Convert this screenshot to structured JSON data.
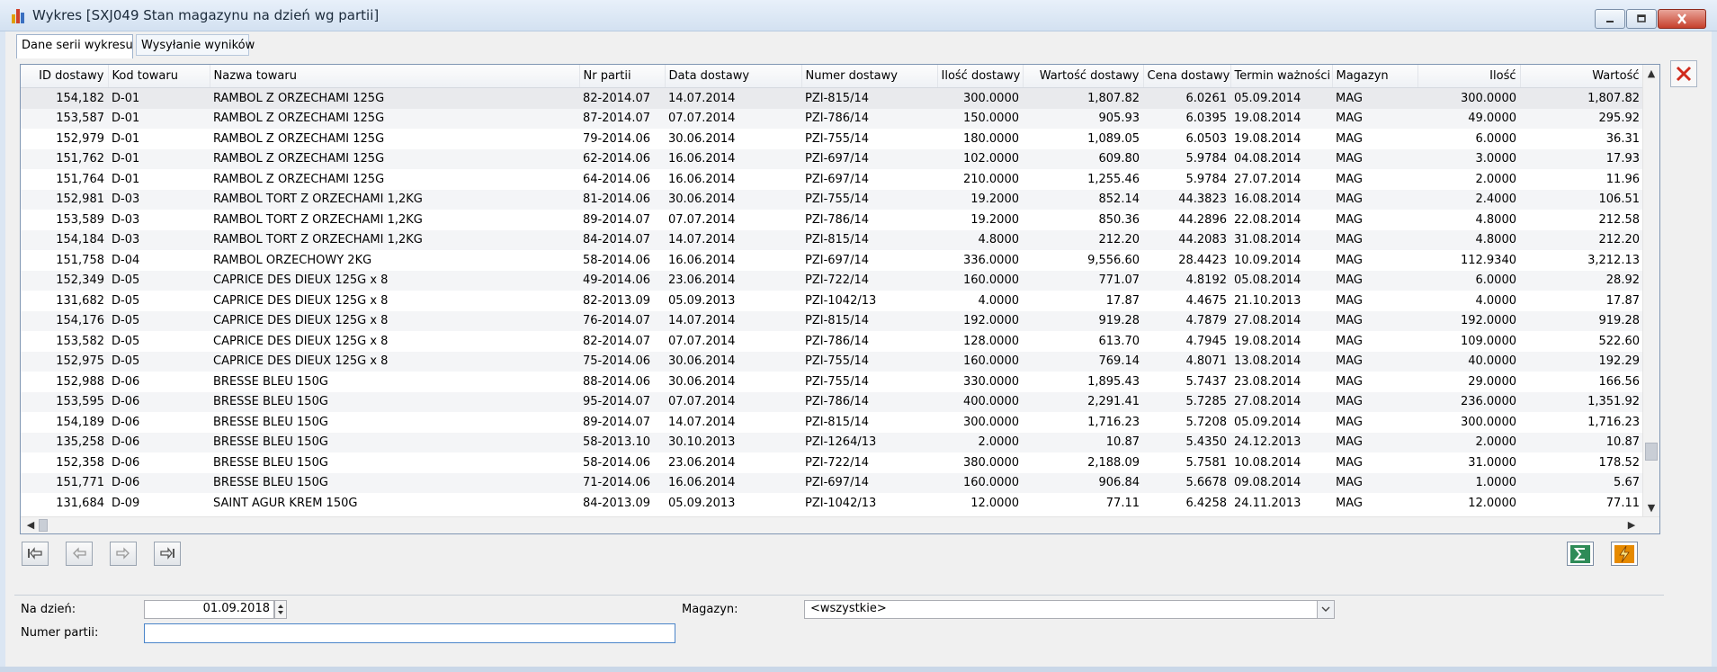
{
  "window": {
    "title": "Wykres [SXJ049 Stan magazynu na dzień wg partii]"
  },
  "tabs": [
    {
      "label": "Dane serii wykresu",
      "active": true
    },
    {
      "label": "Wysyłanie wyników",
      "active": false
    }
  ],
  "grid": {
    "columns": [
      "ID dostawy",
      "Kod towaru",
      "Nazwa towaru",
      "Nr partii",
      "Data dostawy",
      "Numer dostawy",
      "Ilość dostawy",
      "Wartość dostawy",
      "Cena dostawy",
      "Termin ważności",
      "Magazyn",
      "Ilość",
      "Wartość"
    ],
    "rows": [
      [
        "154,182",
        "D-01",
        "RAMBOL Z ORZECHAMI 125G",
        "82-2014.07",
        "14.07.2014",
        "PZI-815/14",
        "300.0000",
        "1,807.82",
        "6.0261",
        "05.09.2014",
        "MAG",
        "300.0000",
        "1,807.82"
      ],
      [
        "153,587",
        "D-01",
        "RAMBOL Z ORZECHAMI 125G",
        "87-2014.07",
        "07.07.2014",
        "PZI-786/14",
        "150.0000",
        "905.93",
        "6.0395",
        "19.08.2014",
        "MAG",
        "49.0000",
        "295.92"
      ],
      [
        "152,979",
        "D-01",
        "RAMBOL Z ORZECHAMI 125G",
        "79-2014.06",
        "30.06.2014",
        "PZI-755/14",
        "180.0000",
        "1,089.05",
        "6.0503",
        "19.08.2014",
        "MAG",
        "6.0000",
        "36.31"
      ],
      [
        "151,762",
        "D-01",
        "RAMBOL Z ORZECHAMI 125G",
        "62-2014.06",
        "16.06.2014",
        "PZI-697/14",
        "102.0000",
        "609.80",
        "5.9784",
        "04.08.2014",
        "MAG",
        "3.0000",
        "17.93"
      ],
      [
        "151,764",
        "D-01",
        "RAMBOL Z ORZECHAMI 125G",
        "64-2014.06",
        "16.06.2014",
        "PZI-697/14",
        "210.0000",
        "1,255.46",
        "5.9784",
        "27.07.2014",
        "MAG",
        "2.0000",
        "11.96"
      ],
      [
        "152,981",
        "D-03",
        "RAMBOL TORT Z ORZECHAMI 1,2KG",
        "81-2014.06",
        "30.06.2014",
        "PZI-755/14",
        "19.2000",
        "852.14",
        "44.3823",
        "16.08.2014",
        "MAG",
        "2.4000",
        "106.51"
      ],
      [
        "153,589",
        "D-03",
        "RAMBOL TORT Z ORZECHAMI 1,2KG",
        "89-2014.07",
        "07.07.2014",
        "PZI-786/14",
        "19.2000",
        "850.36",
        "44.2896",
        "22.08.2014",
        "MAG",
        "4.8000",
        "212.58"
      ],
      [
        "154,184",
        "D-03",
        "RAMBOL TORT Z ORZECHAMI 1,2KG",
        "84-2014.07",
        "14.07.2014",
        "PZI-815/14",
        "4.8000",
        "212.20",
        "44.2083",
        "31.08.2014",
        "MAG",
        "4.8000",
        "212.20"
      ],
      [
        "151,758",
        "D-04",
        "RAMBOL ORZECHOWY 2KG",
        "58-2014.06",
        "16.06.2014",
        "PZI-697/14",
        "336.0000",
        "9,556.60",
        "28.4423",
        "10.09.2014",
        "MAG",
        "112.9340",
        "3,212.13"
      ],
      [
        "152,349",
        "D-05",
        "CAPRICE DES DIEUX 125G x 8",
        "49-2014.06",
        "23.06.2014",
        "PZI-722/14",
        "160.0000",
        "771.07",
        "4.8192",
        "05.08.2014",
        "MAG",
        "6.0000",
        "28.92"
      ],
      [
        "131,682",
        "D-05",
        "CAPRICE DES DIEUX 125G x 8",
        "82-2013.09",
        "05.09.2013",
        "PZI-1042/13",
        "4.0000",
        "17.87",
        "4.4675",
        "21.10.2013",
        "MAG",
        "4.0000",
        "17.87"
      ],
      [
        "154,176",
        "D-05",
        "CAPRICE DES DIEUX 125G x 8",
        "76-2014.07",
        "14.07.2014",
        "PZI-815/14",
        "192.0000",
        "919.28",
        "4.7879",
        "27.08.2014",
        "MAG",
        "192.0000",
        "919.28"
      ],
      [
        "153,582",
        "D-05",
        "CAPRICE DES DIEUX 125G x 8",
        "82-2014.07",
        "07.07.2014",
        "PZI-786/14",
        "128.0000",
        "613.70",
        "4.7945",
        "19.08.2014",
        "MAG",
        "109.0000",
        "522.60"
      ],
      [
        "152,975",
        "D-05",
        "CAPRICE DES DIEUX 125G x 8",
        "75-2014.06",
        "30.06.2014",
        "PZI-755/14",
        "160.0000",
        "769.14",
        "4.8071",
        "13.08.2014",
        "MAG",
        "40.0000",
        "192.29"
      ],
      [
        "152,988",
        "D-06",
        "BRESSE BLEU 150G",
        "88-2014.06",
        "30.06.2014",
        "PZI-755/14",
        "330.0000",
        "1,895.43",
        "5.7437",
        "23.08.2014",
        "MAG",
        "29.0000",
        "166.56"
      ],
      [
        "153,595",
        "D-06",
        "BRESSE BLEU 150G",
        "95-2014.07",
        "07.07.2014",
        "PZI-786/14",
        "400.0000",
        "2,291.41",
        "5.7285",
        "27.08.2014",
        "MAG",
        "236.0000",
        "1,351.92"
      ],
      [
        "154,189",
        "D-06",
        "BRESSE BLEU 150G",
        "89-2014.07",
        "14.07.2014",
        "PZI-815/14",
        "300.0000",
        "1,716.23",
        "5.7208",
        "05.09.2014",
        "MAG",
        "300.0000",
        "1,716.23"
      ],
      [
        "135,258",
        "D-06",
        "BRESSE BLEU 150G",
        "58-2013.10",
        "30.10.2013",
        "PZI-1264/13",
        "2.0000",
        "10.87",
        "5.4350",
        "24.12.2013",
        "MAG",
        "2.0000",
        "10.87"
      ],
      [
        "152,358",
        "D-06",
        "BRESSE BLEU 150G",
        "58-2014.06",
        "23.06.2014",
        "PZI-722/14",
        "380.0000",
        "2,188.09",
        "5.7581",
        "10.08.2014",
        "MAG",
        "31.0000",
        "178.52"
      ],
      [
        "151,771",
        "D-06",
        "BRESSE BLEU 150G",
        "71-2014.06",
        "16.06.2014",
        "PZI-697/14",
        "160.0000",
        "906.84",
        "5.6678",
        "09.08.2014",
        "MAG",
        "1.0000",
        "5.67"
      ],
      [
        "131,684",
        "D-09",
        "SAINT AGUR KREM 150G",
        "84-2013.09",
        "05.09.2013",
        "PZI-1042/13",
        "12.0000",
        "77.11",
        "6.4258",
        "24.11.2013",
        "MAG",
        "12.0000",
        "77.11"
      ]
    ]
  },
  "filters": {
    "na_dzien_label": "Na dzień:",
    "na_dzien_value": "01.09.2018",
    "numer_partii_label": "Numer partii:",
    "numer_partii_value": "",
    "magazyn_label": "Magazyn:",
    "magazyn_value": "<wszystkie>"
  },
  "icons": {
    "nav": [
      "first-page-icon",
      "previous-icon",
      "next-icon",
      "last-page-icon"
    ],
    "tools": [
      "sum-icon",
      "lightning-icon",
      "close-x-icon"
    ]
  },
  "colors": {
    "titlebar": "#d3e1f1",
    "close_red": "#c6412c",
    "sum_green": "#2e8b57",
    "accent_orange": "#e68a00"
  }
}
